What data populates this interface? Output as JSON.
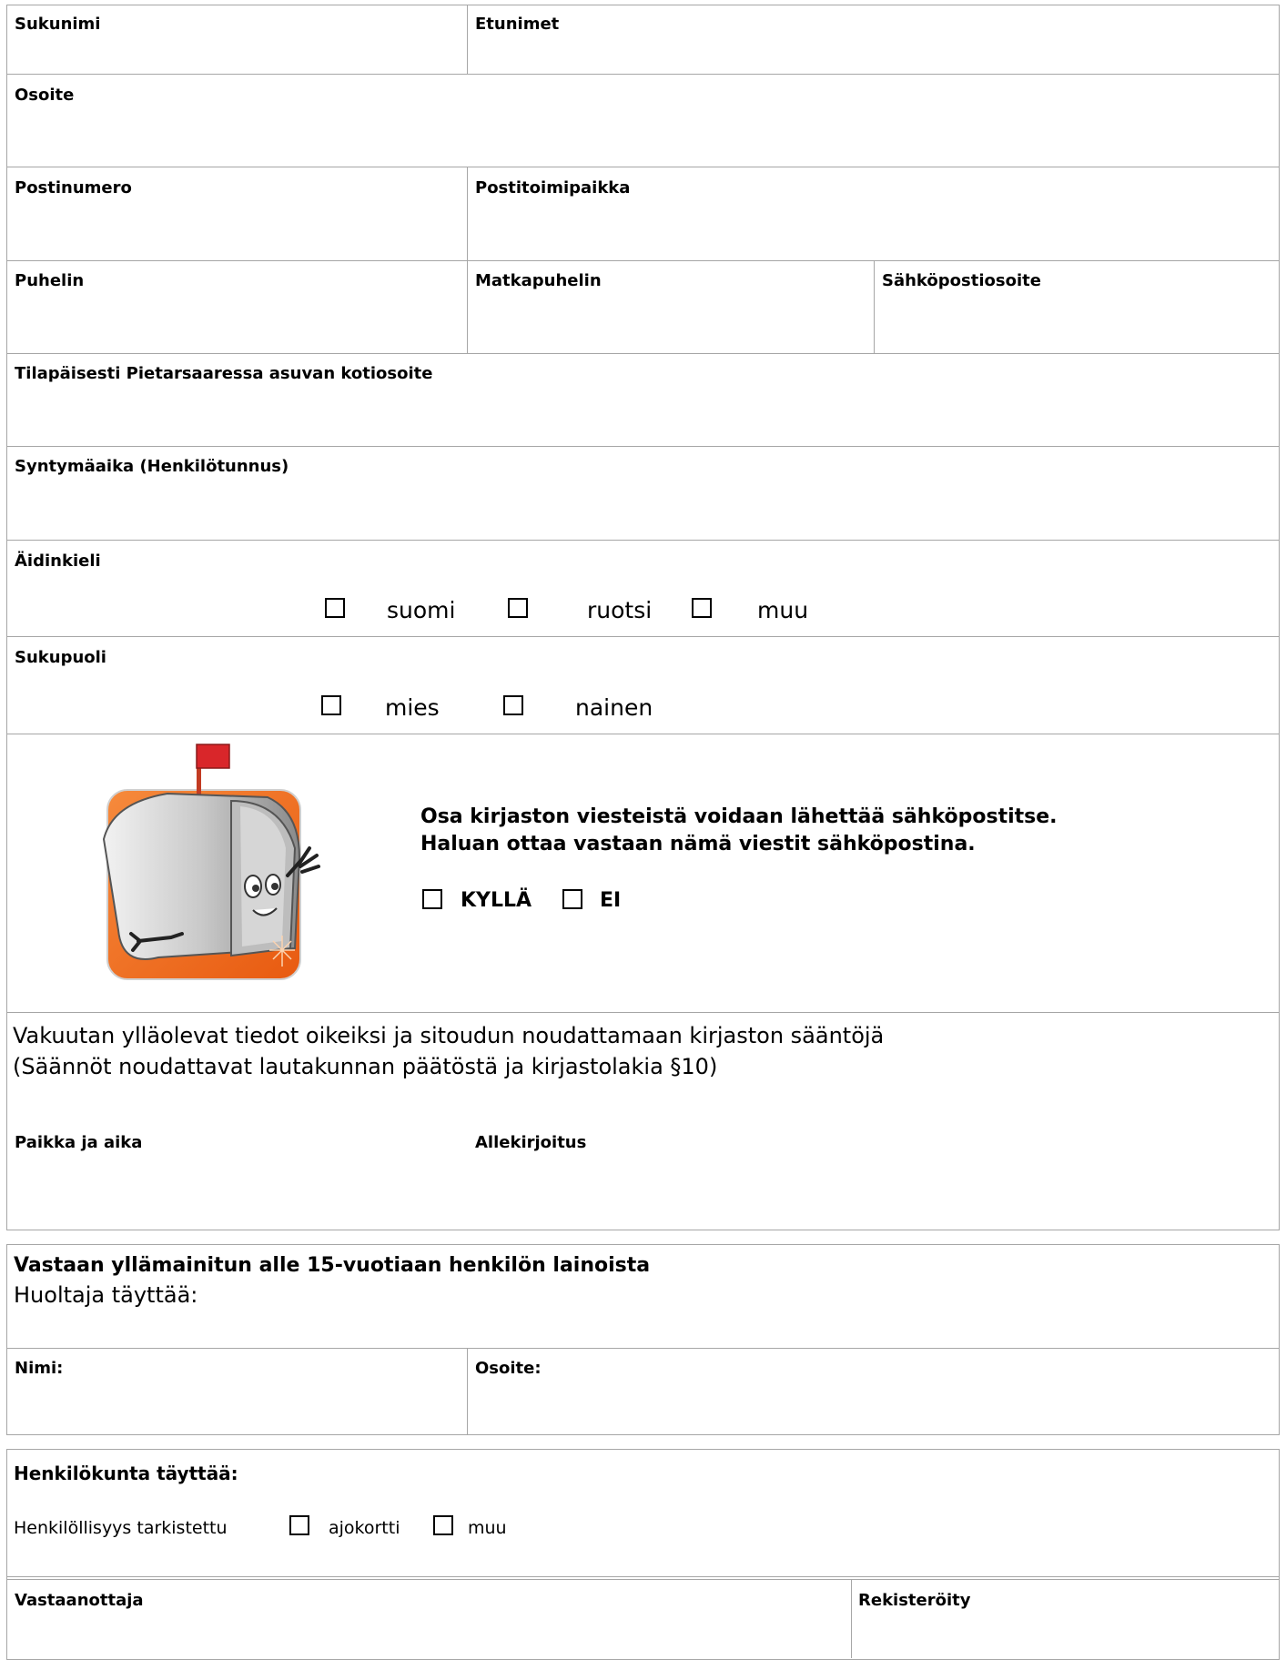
{
  "main": {
    "surname": "Sukunimi",
    "firstnames": "Etunimet",
    "address": "Osoite",
    "postcode": "Postinumero",
    "city": "Postitoimipaikka",
    "phone": "Puhelin",
    "mobile": "Matkapuhelin",
    "email": "Sähköpostiosoite",
    "temp_address": "Tilapäisesti Pietarsaaressa asuvan kotiosoite",
    "birthdate": "Syntymäaika (Henkilötunnus)",
    "mother_tongue": {
      "label": "Äidinkieli",
      "options": [
        "suomi",
        "ruotsi",
        "muu"
      ]
    },
    "gender": {
      "label": "Sukupuoli",
      "options": [
        "mies",
        "nainen"
      ]
    },
    "email_consent": {
      "line1": "Osa kirjaston viesteistä voidaan lähettää sähköpostitse.",
      "line2": "Haluan ottaa vastaan nämä viestit sähköpostina.",
      "yes": "KYLLÄ",
      "no": "EI"
    },
    "declaration": {
      "line1": "Vakuutan ylläolevat tiedot oikeiksi ja sitoudun noudattamaan kirjaston sääntöjä",
      "line2": "(Säännöt noudattavat lautakunnan päätöstä ja kirjastolakia §10)",
      "place_date": "Paikka ja aika",
      "signature": "Allekirjoitus"
    }
  },
  "guardian": {
    "heading": "Vastaan yllämainitun alle 15-vuotiaan henkilön lainoista",
    "subheading": "Huoltaja täyttää:",
    "name": "Nimi:",
    "address": "Osoite:"
  },
  "staff": {
    "heading": "Henkilökunta täyttää:",
    "id_checked": "Henkilöllisyys tarkistettu",
    "options": [
      "ajokortti",
      "muu"
    ],
    "receiver": "Vastaanottaja",
    "registered": "Rekisteröity"
  },
  "colors": {
    "border": "#a6a6a6",
    "accent": "#f26522"
  }
}
